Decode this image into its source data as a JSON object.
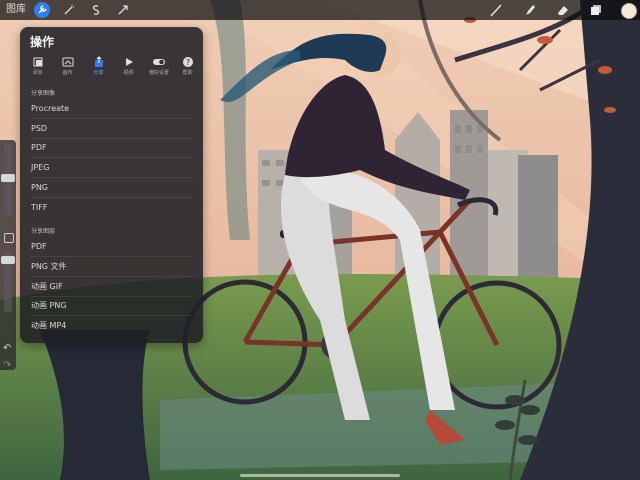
{
  "toolbar": {
    "gallery_label": "图库",
    "left_tools": [
      "wrench-icon",
      "magic-wand-icon",
      "selection-icon",
      "transform-icon"
    ],
    "right_tools": [
      "brush-icon",
      "smudge-icon",
      "eraser-icon",
      "layers-icon",
      "color-swatch"
    ]
  },
  "panel": {
    "title": "操作",
    "tabs": [
      {
        "label": "添加",
        "icon": "add-icon"
      },
      {
        "label": "画布",
        "icon": "canvas-icon"
      },
      {
        "label": "分享",
        "icon": "share-icon",
        "active": true
      },
      {
        "label": "视频",
        "icon": "video-icon"
      },
      {
        "label": "偏好设置",
        "icon": "toggle-icon"
      },
      {
        "label": "帮助",
        "icon": "help-icon"
      }
    ],
    "share_image_label": "分享图像",
    "share_image_items": [
      "Procreate",
      "PSD",
      "PDF",
      "JPEG",
      "PNG",
      "TIFF"
    ],
    "share_layers_label": "分享图层",
    "share_layers_items": [
      "PDF",
      "PNG 文件",
      "动画 GIF",
      "动画 PNG",
      "动画 MP4"
    ]
  },
  "colors": {
    "accent": "#2f7df6",
    "panel_bg": "#202024",
    "current_color": "#f3ead9"
  }
}
